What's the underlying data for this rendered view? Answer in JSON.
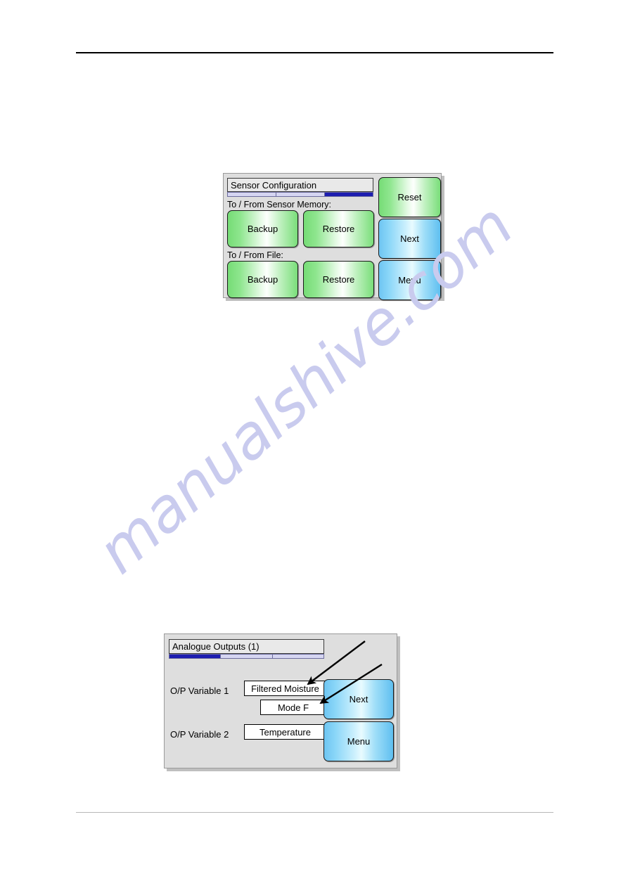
{
  "page": {
    "watermark": "manualshive.com"
  },
  "panel1": {
    "title": "Sensor Configuration",
    "progress": {
      "segments": 3,
      "active_index": 2,
      "fill_color": "#1d1db0",
      "track_color": "#d6d6f2"
    },
    "section_labels": [
      "To / From Sensor Memory:",
      "To / From File:"
    ],
    "buttons": [
      {
        "label": "Backup",
        "color": "green"
      },
      {
        "label": "Restore",
        "color": "green"
      },
      {
        "label": "Backup",
        "color": "green"
      },
      {
        "label": "Restore",
        "color": "green"
      },
      {
        "label": "Reset",
        "color": "green"
      },
      {
        "label": "Next",
        "color": "blue"
      },
      {
        "label": "Menu",
        "color": "blue"
      }
    ]
  },
  "panel2": {
    "title": "Analogue Outputs (1)",
    "progress": {
      "segments": 3,
      "active_index": 0,
      "fill_color": "#1d1db0",
      "track_color": "#d6d6f2"
    },
    "rows": [
      {
        "label": "O/P Variable 1",
        "value": "Filtered Moisture",
        "mode": "Mode F"
      },
      {
        "label": "O/P Variable 2",
        "value": "Temperature"
      }
    ],
    "buttons": [
      {
        "label": "Next",
        "color": "blue"
      },
      {
        "label": "Menu",
        "color": "blue"
      }
    ],
    "annotations": [
      {
        "name": "arrow-to-variable-field"
      },
      {
        "name": "arrow-to-mode-field"
      }
    ]
  },
  "colors": {
    "panel_bg": "#dedede",
    "green_button": "#7ade7a",
    "blue_button": "#6ec5f2",
    "progress_fill": "#1d1db0",
    "watermark": "#c9cbee"
  }
}
